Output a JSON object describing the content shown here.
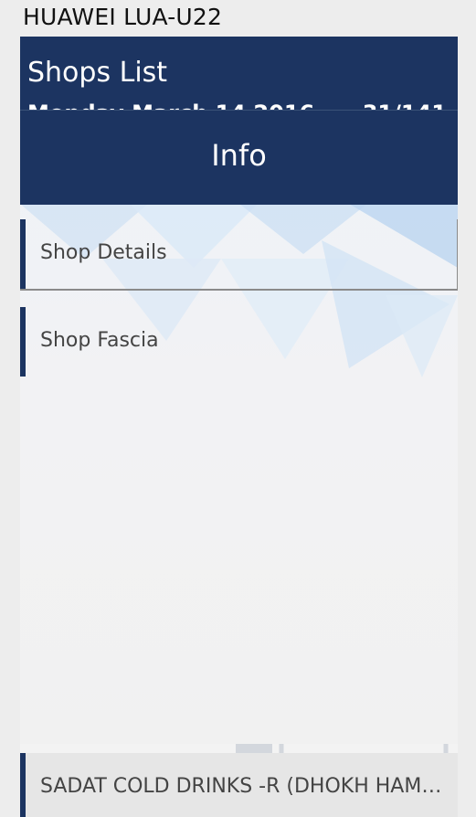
{
  "device": {
    "label": "HUAWEI LUA-U22"
  },
  "appbar": {
    "title": "Shops List",
    "subtitle": "Monday March 14 2016",
    "count": "31/141"
  },
  "dialog": {
    "title": "Info",
    "items": [
      {
        "label": "Shop Details"
      },
      {
        "label": "Shop Fascia"
      }
    ]
  },
  "shops": [
    {
      "label": "SADAT COLD DRINKS -R (DHOKH HAMZA)"
    }
  ],
  "colors": {
    "primary": "#1c3461",
    "background": "#ededed",
    "text": "#444444"
  }
}
